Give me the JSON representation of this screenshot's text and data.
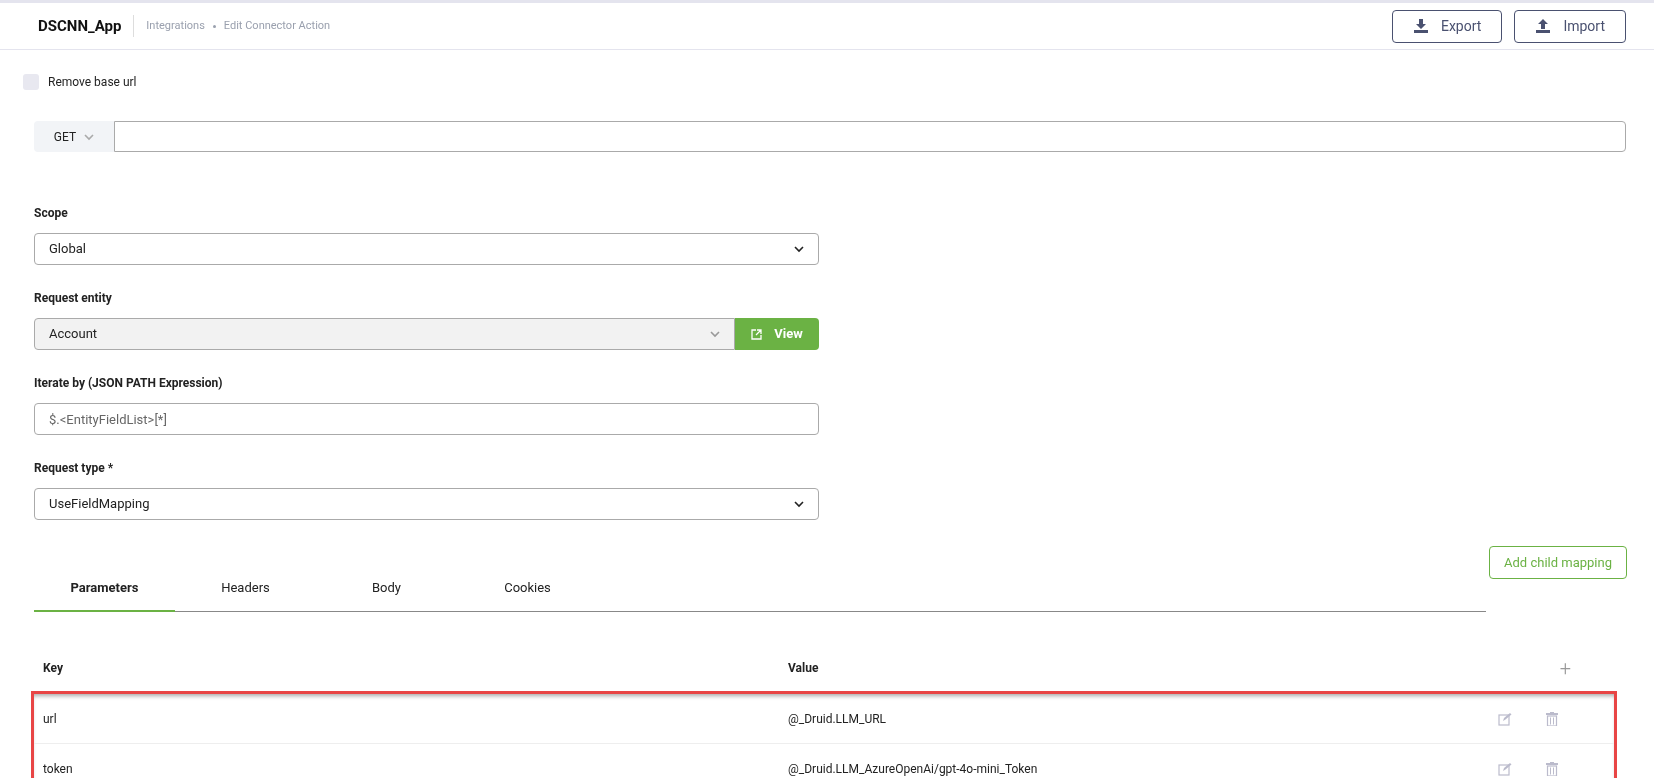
{
  "header": {
    "app_name": "DSCNN_App",
    "breadcrumbs": [
      "Integrations",
      "Edit Connector Action"
    ],
    "buttons": [
      {
        "kind": "export",
        "label": "Export"
      },
      {
        "kind": "import",
        "label": "Import"
      }
    ]
  },
  "remove_base_url": {
    "label": "Remove base url",
    "checked": false
  },
  "request": {
    "method": "GET"
  },
  "fields": [
    {
      "kind": "select",
      "label": "Scope",
      "value": "Global"
    },
    {
      "kind": "select_view",
      "label": "Request entity",
      "value": "Account",
      "button": "View"
    },
    {
      "kind": "input",
      "label": "Iterate by (JSON PATH Expression)",
      "placeholder": "$.<EntityFieldList>[*]"
    },
    {
      "kind": "select",
      "label": "Request type *",
      "value": "UseFieldMapping"
    }
  ],
  "add_child_mapping": "Add child mapping",
  "tabs": [
    {
      "label": "Parameters",
      "selected": true
    },
    {
      "label": "Headers",
      "selected": false
    },
    {
      "label": "Body",
      "selected": false
    },
    {
      "label": "Cookies",
      "selected": false
    }
  ],
  "table": {
    "columns": [
      "Key",
      "Value"
    ],
    "add_icon": "+",
    "rows": [
      {
        "key": "url",
        "value": "@_Druid.LLM_URL"
      },
      {
        "key": "token",
        "value": "@_Druid.LLM_AzureOpenAi/gpt-4o-mini_Token"
      }
    ]
  }
}
